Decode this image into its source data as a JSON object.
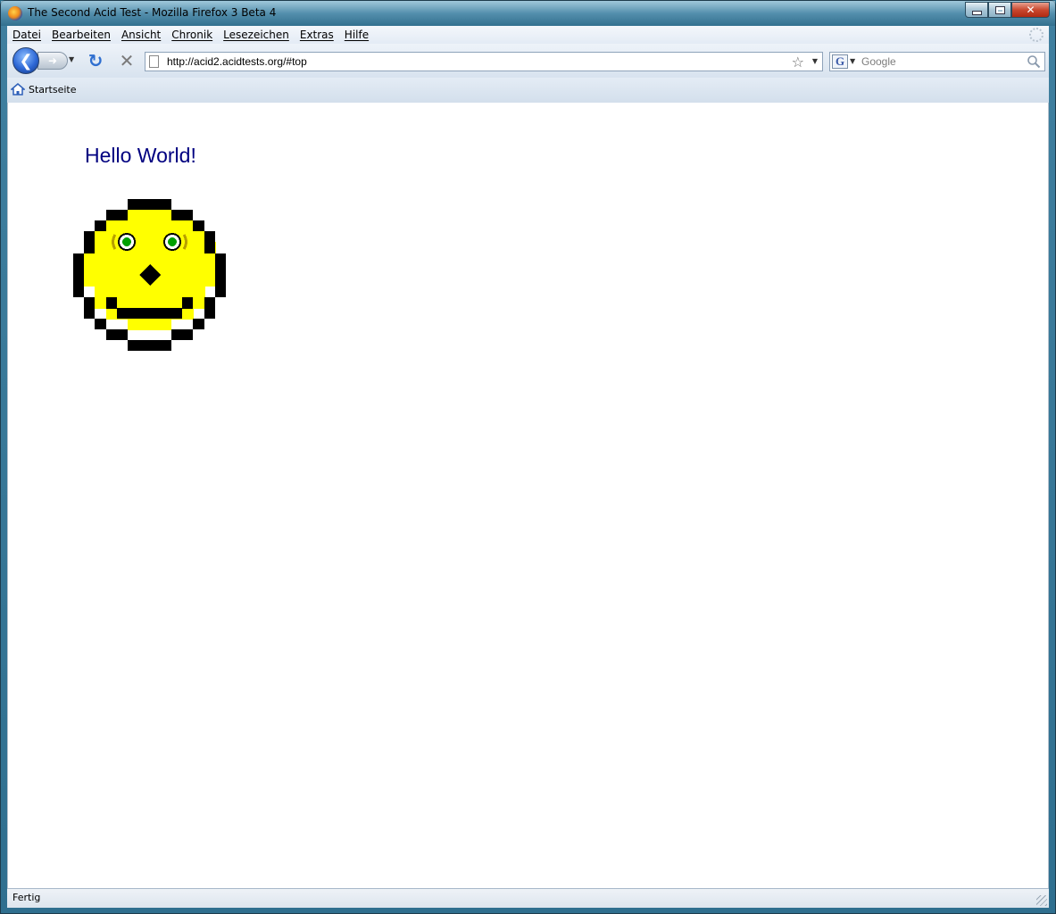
{
  "window": {
    "title": "The Second Acid Test - Mozilla Firefox 3 Beta 4"
  },
  "menubar": {
    "items": [
      "Datei",
      "Bearbeiten",
      "Ansicht",
      "Chronik",
      "Lesezeichen",
      "Extras",
      "Hilfe"
    ]
  },
  "navbar": {
    "url": "http://acid2.acidtests.org/#top",
    "search_placeholder": "Google",
    "search_engine_letter": "G"
  },
  "bookmarks": {
    "items": [
      {
        "label": "Startseite",
        "icon": "home-icon"
      }
    ]
  },
  "page": {
    "heading": "Hello World!",
    "heading_color": "#000080",
    "smiley_face_color": "#ffff00",
    "smiley_outline_color": "#000000",
    "eye_color": "#00a000"
  },
  "statusbar": {
    "text": "Fertig"
  },
  "colors": {
    "chrome_bg": "#dfe9f5",
    "window_frame": "#2f6f8f"
  }
}
